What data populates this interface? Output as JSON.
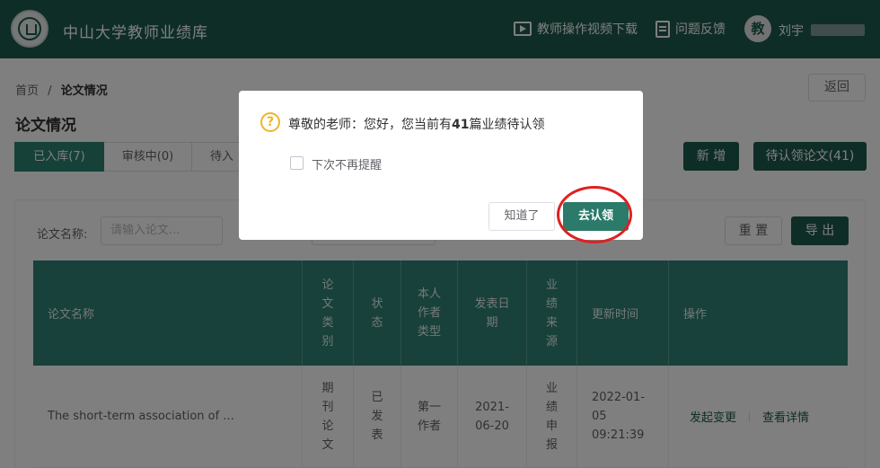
{
  "header": {
    "app_title": "中山大学教师业绩库",
    "video_download": "教师操作视频下载",
    "feedback": "问题反馈",
    "avatar_text": "教",
    "user_name": "刘宇"
  },
  "breadcrumb": {
    "home": "首页",
    "separator": "/",
    "current": "论文情况"
  },
  "back_label": "返回",
  "page_title": "论文情况",
  "tabs": [
    {
      "label": "已入库(7)",
      "active": true
    },
    {
      "label": "审核中(0)",
      "active": false
    },
    {
      "label": "待入",
      "active": false
    }
  ],
  "actions": {
    "new_label": "新 增",
    "claim_label": "待认领论文(41)"
  },
  "filter": {
    "name_label": "论文名称:",
    "name_placeholder": "请输入论文...",
    "reset_label": "重 置",
    "export_label": "导 出"
  },
  "table": {
    "headers": {
      "name": "论文名称",
      "type": "论\n文\n类\n别",
      "status": "状\n态",
      "author_type": "本人\n作者\n类型",
      "pub_date": "发表日\n期",
      "source": "业\n绩\n来\n源",
      "updated": "更新时间",
      "ops": "操作"
    },
    "rows": [
      {
        "name": "The short-term association of ...",
        "type": "期\n刊\n论\n文",
        "status": "已\n发\n表",
        "author_type": "第一\n作者",
        "pub_date": "2021-\n06-20",
        "source": "业\n绩\n申\n报",
        "updated": "2022-01-\n05\n09:21:39",
        "op_change": "发起变更",
        "op_detail": "查看详情"
      }
    ]
  },
  "dialog": {
    "msg_prefix": "尊敬的老师：您好，您当前有",
    "msg_count": "41",
    "msg_suffix": "篇业绩待认领",
    "checkbox_label": "下次不再提醒",
    "ok_label": "知道了",
    "go_label": "去认领"
  },
  "colors": {
    "brand": "#1d5b4c",
    "table_header": "#2f8374",
    "highlight_circle": "#e02020",
    "warning_icon": "#f0b429"
  }
}
